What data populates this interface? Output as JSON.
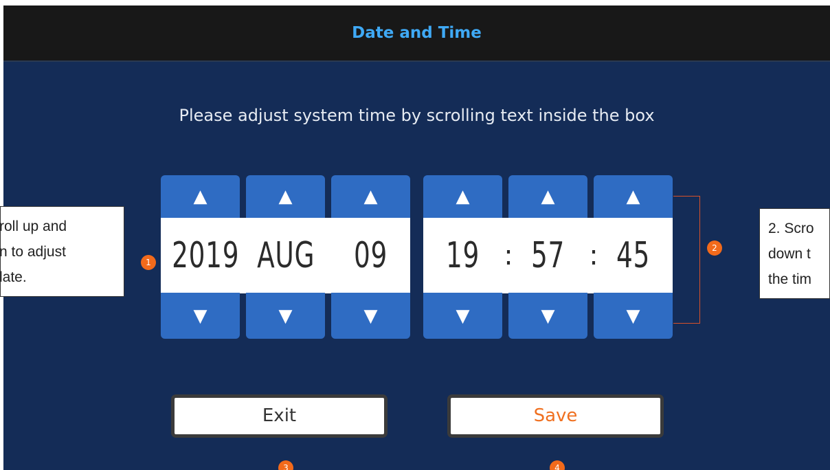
{
  "title": "Date and Time",
  "instruction": "Please adjust system time by scrolling text inside the box",
  "date": {
    "year": "2019",
    "month": "AUG",
    "day": "09"
  },
  "time": {
    "hour": "19",
    "minute": "57",
    "second": "45",
    "separator": ":"
  },
  "arrows": {
    "up": "▲",
    "down": "▼"
  },
  "badges": {
    "one": "1",
    "two": "2",
    "three": "3",
    "four": "4"
  },
  "buttons": {
    "exit": "Exit",
    "save": "Save"
  },
  "callout_left": {
    "line1": "roll up and",
    "line2": "n to adjust",
    "line3": "late."
  },
  "callout_right": {
    "line1": "2. Scro",
    "line2": "down t",
    "line3": "the tim"
  },
  "colors": {
    "background": "#142c57",
    "title": "#3fa9f5",
    "accent": "#f26a1b",
    "picker": "#2f6cc3"
  }
}
